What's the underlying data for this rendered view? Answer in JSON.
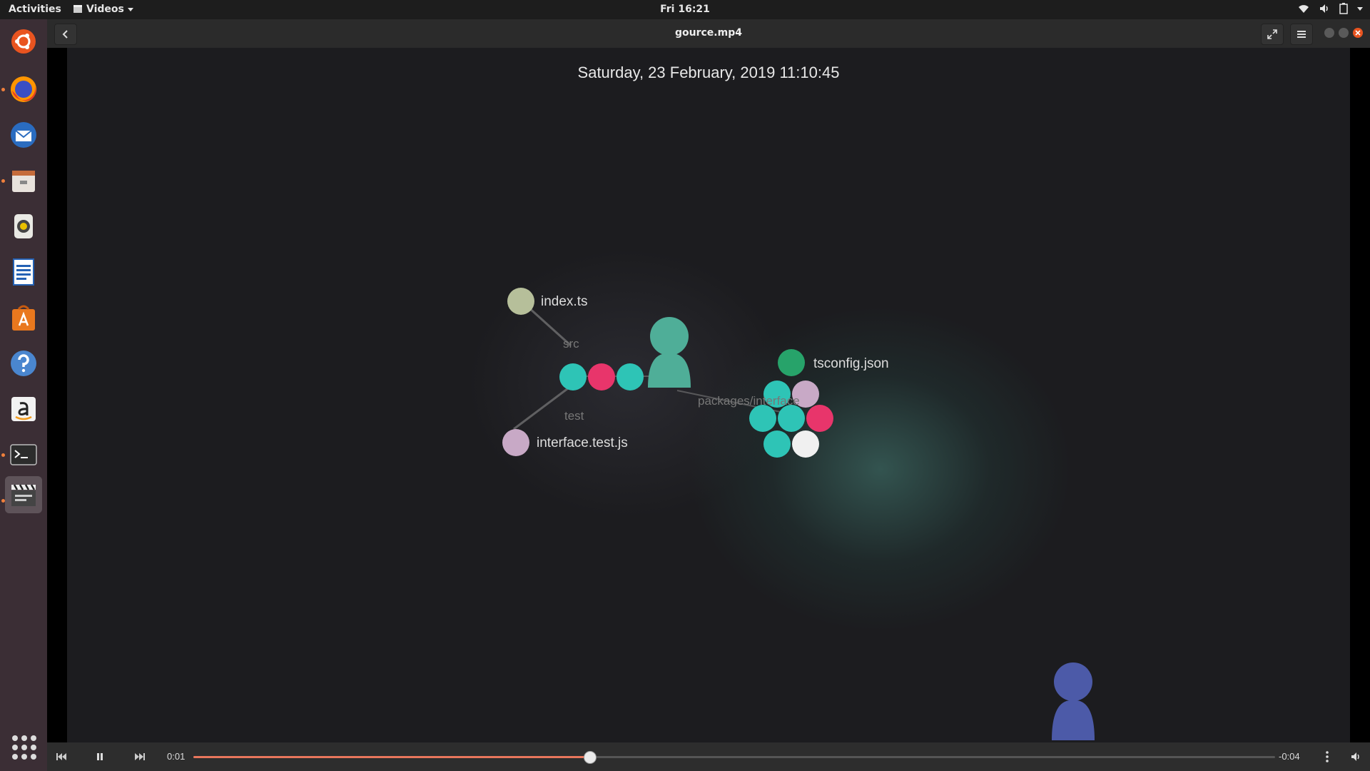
{
  "topbar": {
    "activities": "Activities",
    "app_menu": "Videos",
    "clock": "Fri 16:21"
  },
  "dock": {
    "items": [
      {
        "name": "ubuntu-logo-icon",
        "running": false
      },
      {
        "name": "firefox-icon",
        "running": true
      },
      {
        "name": "thunderbird-icon",
        "running": false
      },
      {
        "name": "files-icon",
        "running": true
      },
      {
        "name": "rhythmbox-icon",
        "running": false
      },
      {
        "name": "libreoffice-writer-icon",
        "running": false
      },
      {
        "name": "software-center-icon",
        "running": false
      },
      {
        "name": "help-icon",
        "running": false
      },
      {
        "name": "amazon-icon",
        "running": false
      },
      {
        "name": "terminal-icon",
        "running": true
      },
      {
        "name": "videos-icon",
        "running": true
      }
    ]
  },
  "window": {
    "title": "gource.mp4"
  },
  "video": {
    "datetime": "Saturday, 23 February, 2019 11:10:45",
    "labels": {
      "index": "index.ts",
      "src": "src",
      "test": "test",
      "interface_test": "interface.test.js",
      "tsconfig": "tsconfig.json",
      "packages": "packages/interface"
    },
    "colors": {
      "cyan": "#2ec4b6",
      "pink": "#e8356b",
      "green": "#27a36a",
      "lavender": "#c8a9c6",
      "olive": "#b6bf9a",
      "user_teal": "#4fae98",
      "user_blue": "#4c5aa8"
    }
  },
  "controls": {
    "elapsed": "0:01",
    "remaining": "-0:04",
    "progress_fraction": 0.366
  }
}
